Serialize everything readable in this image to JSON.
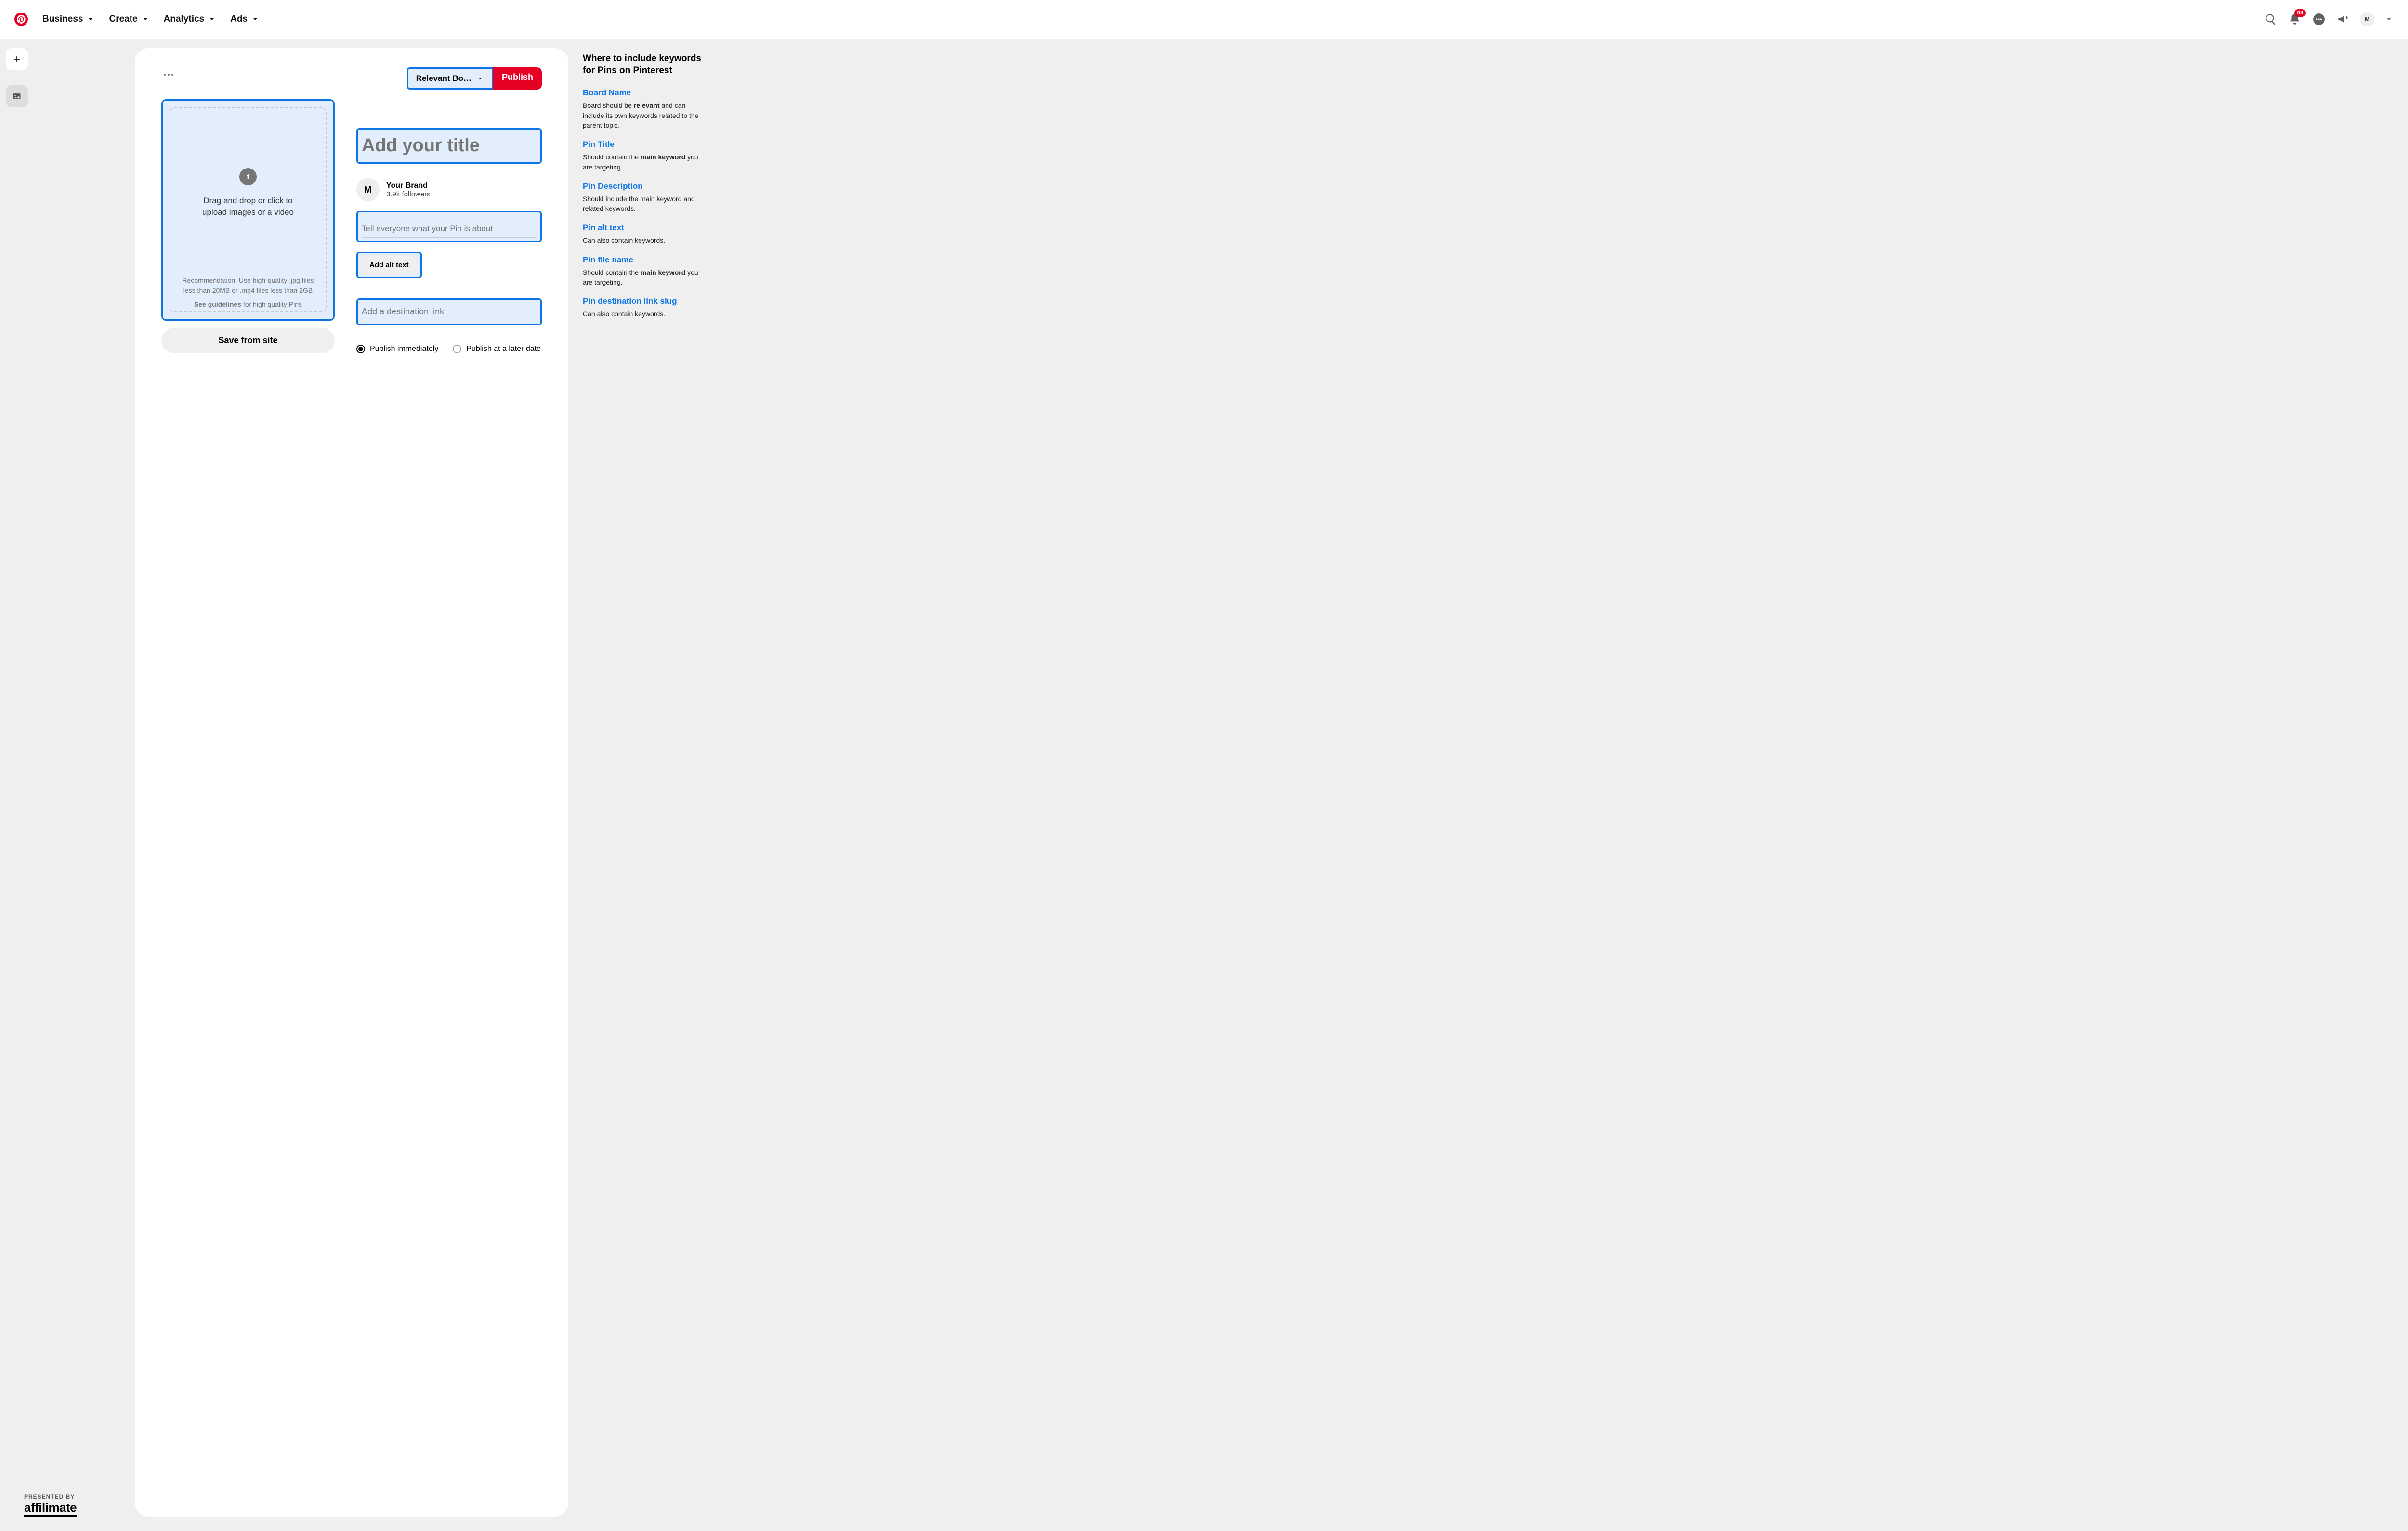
{
  "nav": {
    "items": [
      "Business",
      "Create",
      "Analytics",
      "Ads"
    ],
    "notification_count": "94",
    "avatar_letter": "M"
  },
  "card": {
    "board_selected": "Relevant Bo…",
    "publish_label": "Publish",
    "upload": {
      "main_text": "Drag and drop or click to upload images or a video",
      "rec_line1": "Recommendation: Use high-quality .jpg files less than 20MB or .mp4 files less than 2GB",
      "guidelines_bold": "See guidelines",
      "guidelines_rest": " for high quality Pins"
    },
    "save_from_site": "Save from site",
    "title_placeholder": "Add your title",
    "brand_name": "Your Brand",
    "brand_followers": "3.9k followers",
    "avatar_letter": "M",
    "desc_placeholder": "Tell everyone what your Pin is about",
    "alt_button": "Add alt text",
    "link_placeholder": "Add a destination link",
    "publish_now": "Publish immediately",
    "publish_later": "Publish at a later date"
  },
  "annotations": {
    "heading": "Where to include keywords for Pins on Pinterest",
    "items": [
      {
        "label": "Board Name",
        "text_parts": [
          "Board should be ",
          "relevant",
          " and can include its own keywords related to the parent topic."
        ]
      },
      {
        "label": "Pin Title",
        "text_parts": [
          "Should contain the ",
          "main keyword",
          " you are targeting."
        ]
      },
      {
        "label": "Pin Description",
        "text_parts": [
          "Should include the main keyword and related keywords.",
          "",
          ""
        ]
      },
      {
        "label": "Pin alt text",
        "text_parts": [
          "Can also contain keywords.",
          "",
          ""
        ]
      },
      {
        "label": "Pin file name",
        "text_parts": [
          "Should contain the ",
          "main keyword",
          " you are targeting."
        ]
      },
      {
        "label": "Pin destination link slug",
        "text_parts": [
          "Can also contain keywords.",
          "",
          ""
        ]
      }
    ]
  },
  "presented": {
    "label": "PRESENTED BY",
    "brand": "affilimate"
  }
}
